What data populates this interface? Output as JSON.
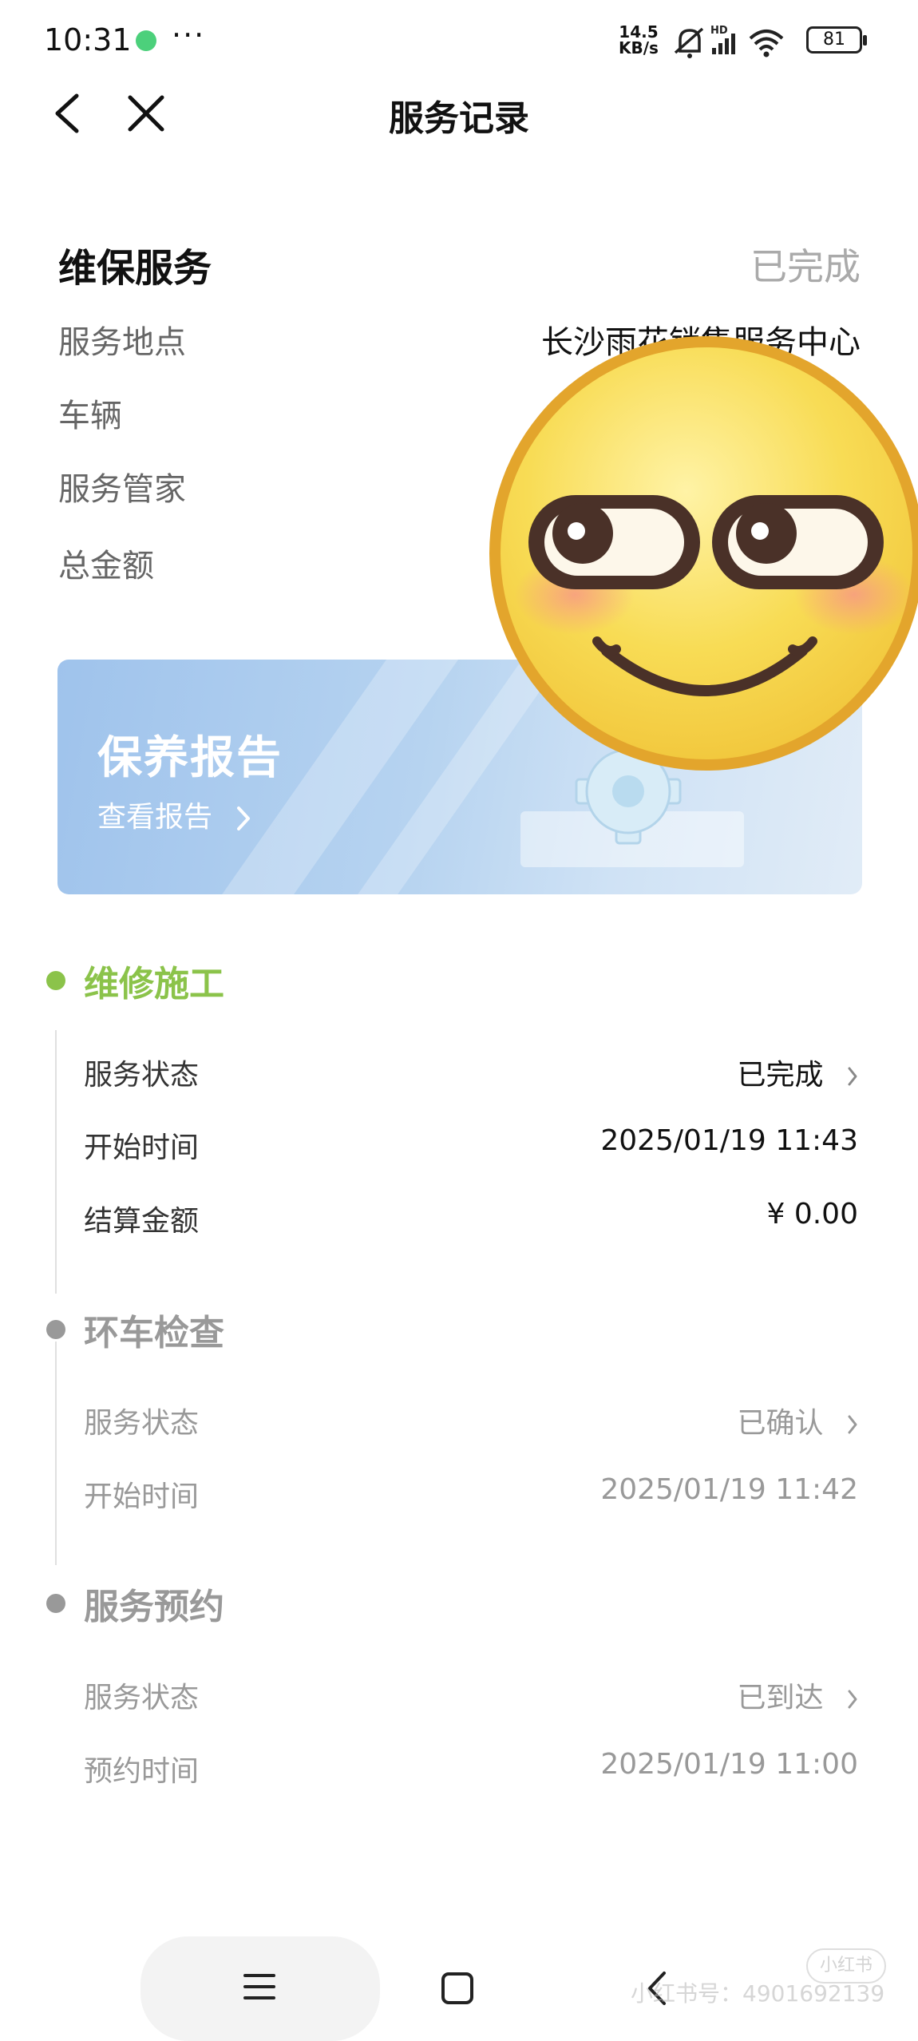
{
  "status_bar": {
    "time": "10:31",
    "more": "···",
    "speed_value": "14.5",
    "speed_unit": "KB/s",
    "hd": "HD",
    "battery": "81"
  },
  "nav": {
    "title": "服务记录",
    "icons": [
      "back-icon",
      "close-icon"
    ]
  },
  "summary": {
    "title": "维保服务",
    "status": "已完成",
    "fields": [
      {
        "label": "服务地点",
        "value": "长沙雨花销售服务中心"
      },
      {
        "label": "车辆",
        "value": ""
      },
      {
        "label": "服务管家",
        "value": ""
      },
      {
        "label": "总金额",
        "value": ""
      }
    ]
  },
  "report_card": {
    "title": "保养报告",
    "link": "查看报告"
  },
  "timeline": [
    {
      "title": "维修施工",
      "active": true,
      "rows": [
        {
          "label": "服务状态",
          "value": "已完成",
          "has_chevron": true
        },
        {
          "label": "开始时间",
          "value": "2025/01/19 11:43",
          "has_chevron": false
        },
        {
          "label": "结算金额",
          "value": "¥  0.00",
          "has_chevron": false
        }
      ]
    },
    {
      "title": "环车检查",
      "active": false,
      "rows": [
        {
          "label": "服务状态",
          "value": "已确认",
          "has_chevron": true
        },
        {
          "label": "开始时间",
          "value": "2025/01/19 11:42",
          "has_chevron": false
        }
      ]
    },
    {
      "title": "服务预约",
      "active": false,
      "rows": [
        {
          "label": "服务状态",
          "value": "已到达",
          "has_chevron": true
        },
        {
          "label": "预约时间",
          "value": "2025/01/19 11:00",
          "has_chevron": false
        }
      ]
    }
  ],
  "colors": {
    "accent_green": "#8bc34a",
    "inactive_gray": "#999999",
    "emoji_face": "#f7d64a",
    "emoji_border": "#e3a52c"
  },
  "watermark": {
    "logo": "小红书",
    "text": "小红书号：4901692139"
  },
  "system_nav": {
    "icons": [
      "menu-icon",
      "home-icon",
      "back-icon"
    ]
  }
}
